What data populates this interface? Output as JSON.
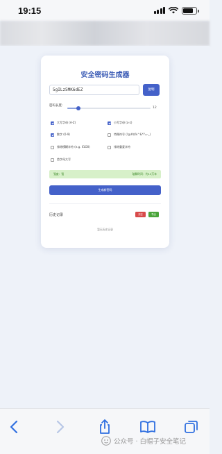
{
  "status_bar": {
    "time": "19:15"
  },
  "app": {
    "title": "安全密码生成器",
    "password_value": "5gILz5MK6dEZ",
    "copy_label": "复制",
    "length_label": "密码长度:",
    "length_value": "12",
    "length_min": 4,
    "length_max": 64,
    "options": [
      {
        "label": "大写字母 (A-Z)",
        "checked": true
      },
      {
        "label": "小写字母 (a-z)",
        "checked": true
      },
      {
        "label": "数字 (0-9)",
        "checked": true
      },
      {
        "label": "特殊符号 (!@#$%^&*?=-_)",
        "checked": false
      },
      {
        "label": "排除模糊字符 (e.g. Il1O0)",
        "checked": false
      },
      {
        "label": "排除重复字符",
        "checked": false
      },
      {
        "label": "首字母大写",
        "checked": false
      }
    ],
    "strength_label": "强度：强",
    "crack_time_label": "破解时间：约10万年",
    "generate_label": "生成新密码",
    "history_title": "历史记录",
    "clear_label": "清空",
    "export_label": "导出",
    "history_empty": "暂无历史记录"
  },
  "toolbar": {
    "icons": [
      "back-icon",
      "forward-icon",
      "share-icon",
      "bookmarks-icon",
      "tabs-icon"
    ]
  },
  "watermark": {
    "text": "公众号 · 白帽子安全笔记"
  },
  "colors": {
    "accent": "#4461c9",
    "strength_bg": "#d7f0c9",
    "danger": "#d84a4a",
    "success": "#4aa53a"
  }
}
